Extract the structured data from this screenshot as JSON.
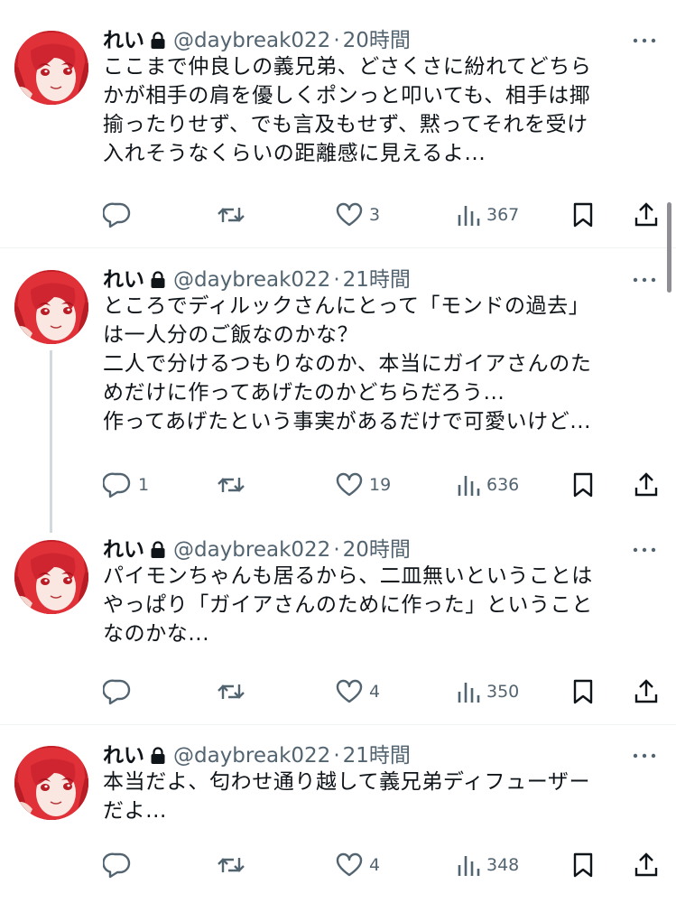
{
  "tweets": [
    {
      "name": "れい",
      "handle": "@daybreak022",
      "dot": "·",
      "time": "20時間",
      "text": "ここまで仲良しの義兄弟、どさくさに紛れてどちら\nかが相手の肩を優しくポンっと叩いても、相手は揶\n揄ったりせず、でも言及もせず、黙ってそれを受け\n入れそうなくらいの距離感に見えるよ...",
      "replies": "",
      "retweets": "",
      "likes": "3",
      "views": "367"
    },
    {
      "name": "れい",
      "handle": "@daybreak022",
      "dot": "·",
      "time": "21時間",
      "text": "ところでディルックさんにとって「モンドの過去」\nは一人分のご飯なのかな？\n二人で分けるつもりなのか、本当にガイアさんのた\nめだけに作ってあげたのかどちらだろう...\n作ってあげたという事実があるだけで可愛いけど...",
      "replies": "1",
      "retweets": "",
      "likes": "19",
      "views": "636"
    },
    {
      "name": "れい",
      "handle": "@daybreak022",
      "dot": "·",
      "time": "20時間",
      "text": "パイモンちゃんも居るから、二皿無いということは\nやっぱり「ガイアさんのために作った」ということ\nなのかな...",
      "replies": "",
      "retweets": "",
      "likes": "4",
      "views": "350"
    },
    {
      "name": "れい",
      "handle": "@daybreak022",
      "dot": "·",
      "time": "21時間",
      "text": "本当だよ、匂わせ通り越して義兄弟ディフューザー\nだよ...",
      "replies": "",
      "retweets": "",
      "likes": "4",
      "views": "348"
    }
  ],
  "icons": {
    "lock": "lock-icon",
    "more": "more-icon",
    "reply": "reply-icon",
    "retweet": "retweet-icon",
    "like": "heart-icon",
    "views": "views-icon",
    "bookmark": "bookmark-icon",
    "share": "share-icon"
  },
  "colors": {
    "text": "#0f1419",
    "secondary": "#536471",
    "divider": "#eff3f4",
    "thread_line": "#cfd9de",
    "avatar_hair": "#c8202a"
  }
}
